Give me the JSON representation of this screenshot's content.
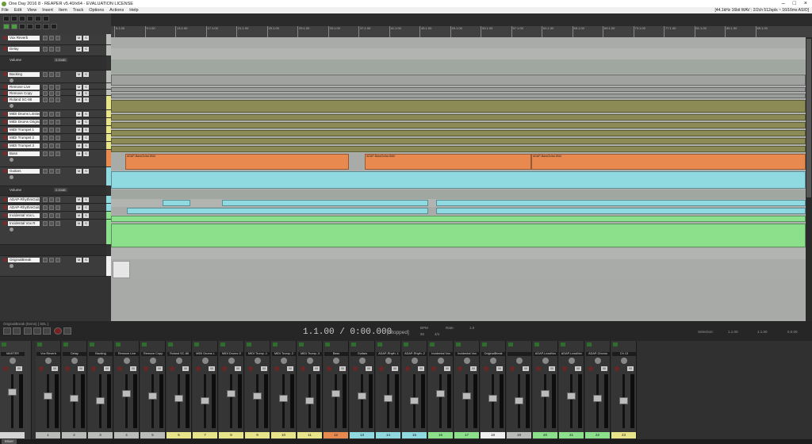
{
  "window": {
    "title": "One Day 2016 8 - REAPER v5.40/x64 - EVALUATION LICENSE",
    "menu": [
      "File",
      "Edit",
      "View",
      "Insert",
      "Item",
      "Track",
      "Options",
      "Actions",
      "Help"
    ],
    "audio_info": "[44.1kHz 16bit WAV : 2/2ch 512spls ~ 16/16ms ASIO]"
  },
  "ruler": {
    "bars": [
      "5.1.00",
      "9.1.00",
      "13.1.00",
      "17.1.00",
      "21.1.00",
      "25.1.00",
      "29.1.00",
      "33.1.00",
      "37.1.00",
      "41.1.00",
      "45.1.00",
      "49.1.00",
      "53.1.00",
      "57.1.00",
      "61.1.00",
      "65.1.00",
      "69.1.00",
      "73.1.00",
      "77.1.00",
      "81.1.00",
      "85.1.00",
      "89.1.00"
    ]
  },
  "tracks": [
    {
      "name": "Vox Reverb",
      "color": "#b9bcb9"
    },
    {
      "name": "Delay",
      "color": "#b9bcb9"
    },
    {
      "name": "Backing",
      "color": "#b9bcb9"
    },
    {
      "name": "Remove Live",
      "color": "#b9bcb9"
    },
    {
      "name": "Remove Copy",
      "color": "#b9bcb9"
    },
    {
      "name": "Roland SC-88",
      "color": "#e8e48a"
    },
    {
      "name": "MIDI Drums Limited",
      "color": "#e8e48a"
    },
    {
      "name": "MIDI Drums Original",
      "color": "#e8e48a"
    },
    {
      "name": "MIDI Trumpet 1",
      "color": "#e8e48a"
    },
    {
      "name": "MIDI Trumpet 2",
      "color": "#e8e48a"
    },
    {
      "name": "MIDI Trumpet 3",
      "color": "#e8e48a"
    },
    {
      "name": "Bass",
      "color": "#e8894f"
    },
    {
      "name": "Guitars",
      "color": "#8fd9e0"
    },
    {
      "name": "ADAP-RhythmGuitar1",
      "color": "#8fd9e0"
    },
    {
      "name": "ADAP-RhythmGuitar2",
      "color": "#8fd9e0"
    },
    {
      "name": "Incidental Vox L",
      "color": "#8ce08c"
    },
    {
      "name": "Incidental Vox R",
      "color": "#8ce08c"
    },
    {
      "name": "OriginalBreak",
      "color": "#f0f0f0"
    },
    {
      "name": "ADAP-LeadVocal",
      "color": "#8ce08c"
    }
  ],
  "envelopes": {
    "volume_label": "Volume",
    "volume_value": "0.00dB"
  },
  "item_labels": {
    "bass": "ADAP-BassGuitar.WAV",
    "lead": "ADAP-LeadVocal.WAV",
    "rhythm": "ADAP-RhythmGuitar.WAV"
  },
  "transport": {
    "time": "1.1.00 / 0:00.000",
    "state": "[Stopped]",
    "bpm_label": "BPM",
    "bpm": "90",
    "rate_label": "Rate:",
    "rate": "1.0",
    "sig": "4/4",
    "selection_label": "Selection:",
    "sel_start": "1.1.00",
    "sel_end": "1.1.00",
    "sel_len": "0.0.00",
    "track_label": "OriginalBreak (Items) [ SEL ]"
  },
  "mixer": {
    "strips": [
      {
        "name": "MASTER",
        "num": "",
        "color": "#d4d4d4"
      },
      {
        "name": "Vox Reverb",
        "num": "1",
        "color": "#b9bcb9"
      },
      {
        "name": "Delay",
        "num": "2",
        "color": "#b9bcb9"
      },
      {
        "name": "Backing",
        "num": "3",
        "color": "#b9bcb9"
      },
      {
        "name": "Remove Live",
        "num": "4",
        "color": "#b9bcb9"
      },
      {
        "name": "Remove Copy",
        "num": "5",
        "color": "#b9bcb9"
      },
      {
        "name": "Roland SC-88",
        "num": "6",
        "color": "#e8e48a"
      },
      {
        "name": "MIDI Drums L",
        "num": "7",
        "color": "#e8e48a"
      },
      {
        "name": "MIDI Drums O",
        "num": "8",
        "color": "#e8e48a"
      },
      {
        "name": "MIDI Trump..1",
        "num": "9",
        "color": "#e8e48a"
      },
      {
        "name": "MIDI Trump..2",
        "num": "10",
        "color": "#e8e48a"
      },
      {
        "name": "MIDI Trump..3",
        "num": "11",
        "color": "#e8e48a"
      },
      {
        "name": "Bass",
        "num": "12",
        "color": "#e8894f"
      },
      {
        "name": "Guitars",
        "num": "13",
        "color": "#8fd9e0"
      },
      {
        "name": "ADAP-Rhyth..1",
        "num": "14",
        "color": "#8fd9e0"
      },
      {
        "name": "ADAP-Rhyth..2",
        "num": "15",
        "color": "#8fd9e0"
      },
      {
        "name": "Incidental Vox",
        "num": "16",
        "color": "#8ce08c"
      },
      {
        "name": "Incidental Vox",
        "num": "17",
        "color": "#8ce08c"
      },
      {
        "name": "OriginalBreak",
        "num": "18",
        "color": "#f0f0f0"
      },
      {
        "name": "",
        "num": "19",
        "color": "#b9bcb9"
      },
      {
        "name": "ADAP-LeadVoc",
        "num": "20",
        "color": "#8ce08c"
      },
      {
        "name": "ADAP-LeadVoc",
        "num": "21",
        "color": "#8ce08c"
      },
      {
        "name": "ADAP-Chorus",
        "num": "22",
        "color": "#8ce08c"
      },
      {
        "name": "Ch 13",
        "num": "23",
        "color": "#e8e48a"
      }
    ]
  },
  "mixer_tab": "Mixer"
}
